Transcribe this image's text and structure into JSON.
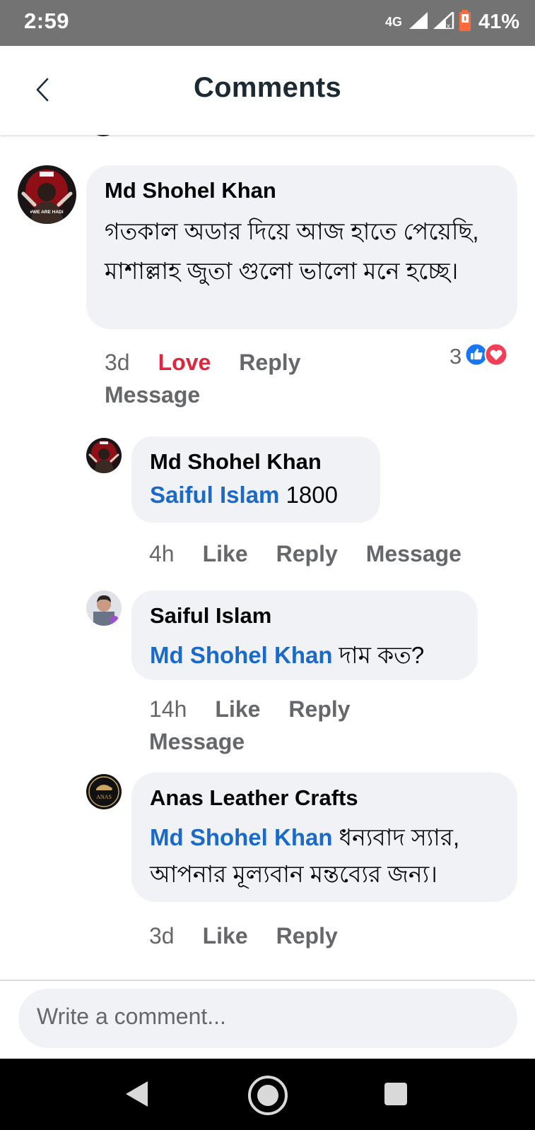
{
  "status_bar": {
    "time": "2:59",
    "network": "4G",
    "battery": "41%"
  },
  "header": {
    "title": "Comments"
  },
  "comments": [
    {
      "author": "Md Shohel Khan",
      "text": "গতকাল অডার দিয়ে আজ হাতে পেয়েছি, মাশাল্লাহ জুতা গুলো ভালো মনে হচ্ছে।",
      "time": "3d",
      "reaction_label": "Love",
      "reply": "Reply",
      "message": "Message",
      "reaction_count": "3",
      "reaction_icons": [
        "like-icon",
        "love-icon"
      ]
    },
    {
      "author": "Md Shohel Khan",
      "mention": "Saiful Islam",
      "text": "1800",
      "time": "4h",
      "like": "Like",
      "reply": "Reply",
      "message": "Message"
    },
    {
      "author": "Saiful Islam",
      "mention": "Md Shohel Khan",
      "text": "দাম কত?",
      "time": "14h",
      "like": "Like",
      "reply": "Reply",
      "message": "Message"
    },
    {
      "author": "Anas Leather Crafts",
      "mention": "Md Shohel Khan",
      "text": "ধন্যবাদ স্যার, আপনার মূল্যবান মন্তব্যের জন্য।",
      "time": "3d",
      "like": "Like",
      "reply": "Reply"
    }
  ],
  "avatars": {
    "poster_badge": "#WE ARE HADI",
    "anas_logo": "ANAS"
  },
  "composer": {
    "placeholder": "Write a comment..."
  },
  "colors": {
    "mention": "#1b6ac9",
    "love": "#e0263e",
    "bubble": "#f0f2f5",
    "meta": "#65676b"
  }
}
